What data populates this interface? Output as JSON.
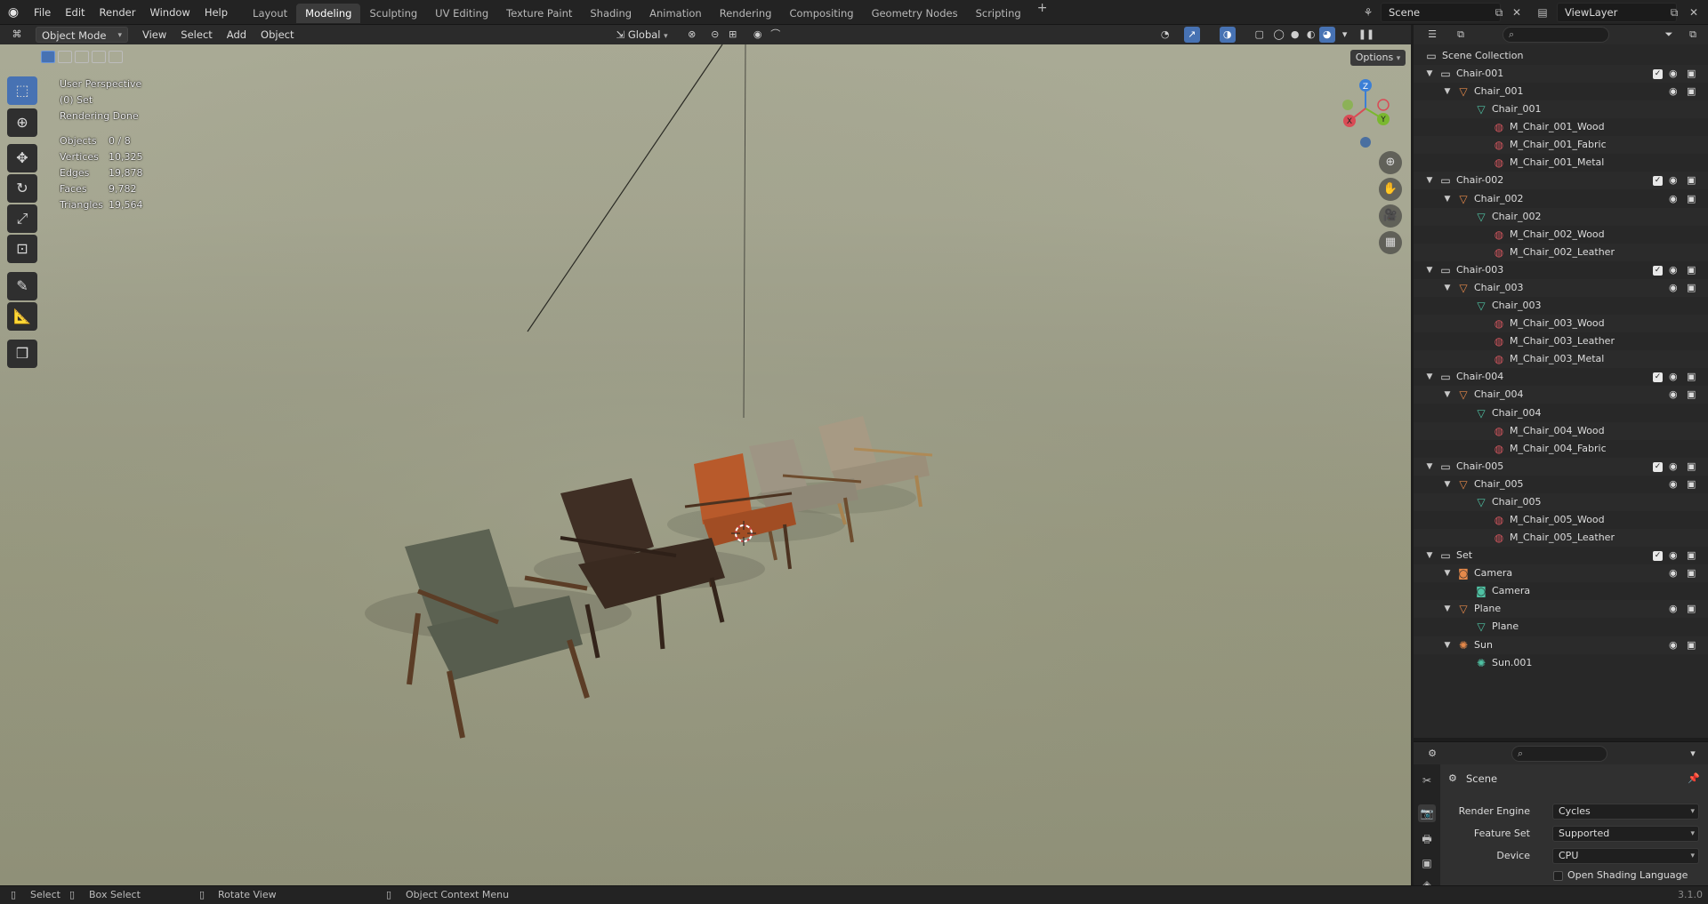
{
  "menubar": {
    "items": [
      "File",
      "Edit",
      "Render",
      "Window",
      "Help"
    ],
    "workspaces": [
      "Layout",
      "Modeling",
      "Sculpting",
      "UV Editing",
      "Texture Paint",
      "Shading",
      "Animation",
      "Rendering",
      "Compositing",
      "Geometry Nodes",
      "Scripting"
    ],
    "active_workspace": "Modeling",
    "add_tab": "+",
    "scene": "Scene",
    "view_layer": "ViewLayer"
  },
  "viewport_header": {
    "mode": "Object Mode",
    "menus": [
      "View",
      "Select",
      "Add",
      "Object"
    ],
    "transform_orientation": "Global",
    "options": "Options"
  },
  "overlay": {
    "perspective": "User Perspective",
    "collection": "(0) Set",
    "status": "Rendering Done",
    "stats": [
      {
        "label": "Objects",
        "value": "0 / 8"
      },
      {
        "label": "Vertices",
        "value": "10,325"
      },
      {
        "label": "Edges",
        "value": "19,878"
      },
      {
        "label": "Faces",
        "value": "9,782"
      },
      {
        "label": "Triangles",
        "value": "19,564"
      }
    ]
  },
  "gizmo": {
    "x": "X",
    "y": "Y",
    "z": "Z"
  },
  "colors": {
    "accent": "#4772b3",
    "collection_icon": "#dcdcdc",
    "object_orange": "#e5894a",
    "mesh_green": "#4fc1a3",
    "material_red": "#d0555d"
  },
  "outliner": {
    "root": "Scene Collection",
    "rows": [
      {
        "label": "Chair-001",
        "type": "collection",
        "depth": 0
      },
      {
        "label": "Chair_001",
        "type": "object",
        "depth": 1
      },
      {
        "label": "Chair_001",
        "type": "mesh",
        "depth": 2
      },
      {
        "label": "M_Chair_001_Wood",
        "type": "material",
        "depth": 3
      },
      {
        "label": "M_Chair_001_Fabric",
        "type": "material",
        "depth": 3
      },
      {
        "label": "M_Chair_001_Metal",
        "type": "material",
        "depth": 3
      },
      {
        "label": "Chair-002",
        "type": "collection",
        "depth": 0
      },
      {
        "label": "Chair_002",
        "type": "object",
        "depth": 1
      },
      {
        "label": "Chair_002",
        "type": "mesh",
        "depth": 2
      },
      {
        "label": "M_Chair_002_Wood",
        "type": "material",
        "depth": 3
      },
      {
        "label": "M_Chair_002_Leather",
        "type": "material",
        "depth": 3
      },
      {
        "label": "Chair-003",
        "type": "collection",
        "depth": 0
      },
      {
        "label": "Chair_003",
        "type": "object",
        "depth": 1
      },
      {
        "label": "Chair_003",
        "type": "mesh",
        "depth": 2
      },
      {
        "label": "M_Chair_003_Wood",
        "type": "material",
        "depth": 3
      },
      {
        "label": "M_Chair_003_Leather",
        "type": "material",
        "depth": 3
      },
      {
        "label": "M_Chair_003_Metal",
        "type": "material",
        "depth": 3
      },
      {
        "label": "Chair-004",
        "type": "collection",
        "depth": 0
      },
      {
        "label": "Chair_004",
        "type": "object",
        "depth": 1
      },
      {
        "label": "Chair_004",
        "type": "mesh",
        "depth": 2
      },
      {
        "label": "M_Chair_004_Wood",
        "type": "material",
        "depth": 3
      },
      {
        "label": "M_Chair_004_Fabric",
        "type": "material",
        "depth": 3
      },
      {
        "label": "Chair-005",
        "type": "collection",
        "depth": 0
      },
      {
        "label": "Chair_005",
        "type": "object",
        "depth": 1
      },
      {
        "label": "Chair_005",
        "type": "mesh",
        "depth": 2
      },
      {
        "label": "M_Chair_005_Wood",
        "type": "material",
        "depth": 3
      },
      {
        "label": "M_Chair_005_Leather",
        "type": "material",
        "depth": 3
      },
      {
        "label": "Set",
        "type": "collection",
        "depth": 0
      },
      {
        "label": "Camera",
        "type": "camera",
        "depth": 1
      },
      {
        "label": "Camera",
        "type": "camera-data",
        "depth": 2
      },
      {
        "label": "Plane",
        "type": "object",
        "depth": 1
      },
      {
        "label": "Plane",
        "type": "mesh",
        "depth": 2
      },
      {
        "label": "Sun",
        "type": "light",
        "depth": 1
      },
      {
        "label": "Sun.001",
        "type": "light-data",
        "depth": 2
      }
    ]
  },
  "properties": {
    "context": "Scene",
    "fields": [
      {
        "label": "Render Engine",
        "value": "Cycles"
      },
      {
        "label": "Feature Set",
        "value": "Supported"
      },
      {
        "label": "Device",
        "value": "CPU"
      }
    ],
    "checkbox": "Open Shading Language"
  },
  "statusbar": {
    "select": "Select",
    "box_select": "Box Select",
    "rotate": "Rotate View",
    "context_menu": "Object Context Menu",
    "version": "3.1.0"
  }
}
